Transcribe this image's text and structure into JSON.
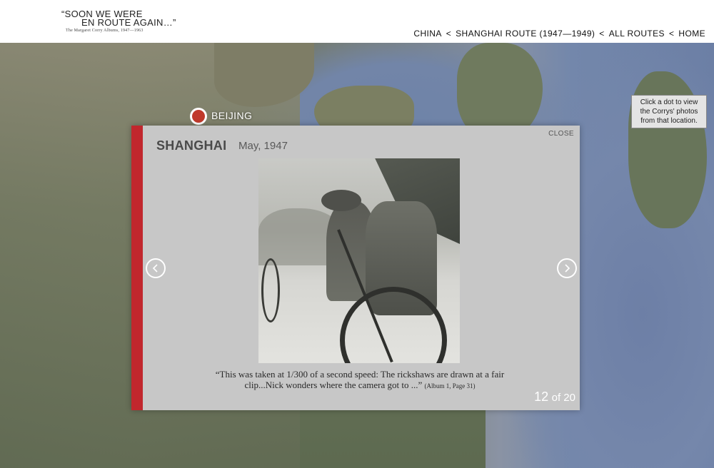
{
  "logo": {
    "line1": "“SOON WE WERE",
    "line2": "EN ROUTE AGAIN…”",
    "subtitle": "The Margaret Corry Albums, 1947—1963"
  },
  "breadcrumb": {
    "items": [
      "CHINA",
      "SHANGHAI ROUTE (1947—1949)",
      "ALL ROUTES",
      "HOME"
    ],
    "separator": "<"
  },
  "map": {
    "city_label": "BEIJING",
    "dot_color": "#c0392b",
    "hint": "Click a dot to view the Corrys' photos from that location."
  },
  "modal": {
    "title": "SHANGHAI",
    "date": "May, 1947",
    "close_label": "CLOSE",
    "caption": "“This was taken at 1/300 of a second speed: The rickshaws are drawn at a fair clip...Nick wonders where the camera got to ...”",
    "citation": "(Album 1, Page 31)",
    "counter_current": "12",
    "counter_total": "of 20",
    "accent_color": "#c1272d"
  }
}
